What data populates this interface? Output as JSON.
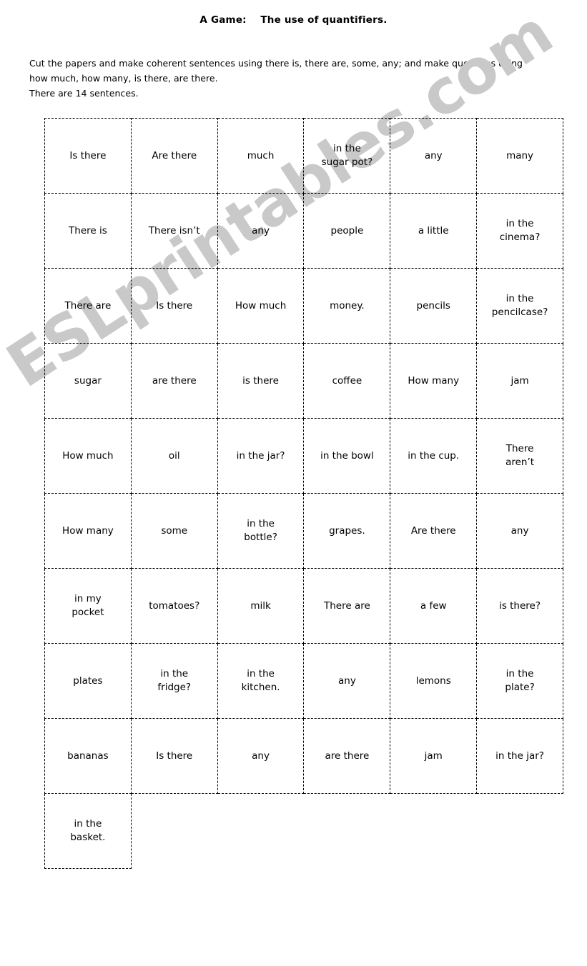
{
  "document": {
    "title": "A Game:    The use of quantifiers.",
    "instructions": {
      "line1": "Cut the papers and make coherent sentences using there is, there are, some, any; and make questions using",
      "line2": "how much, how many, is there, are there.",
      "line3": "There are 14 sentences."
    },
    "watermark": "ESLprintables.com",
    "colors": {
      "text": "#000000",
      "watermark": "#c9c9c9",
      "background": "#ffffff",
      "border": "#000000"
    }
  },
  "table": {
    "columns": 6,
    "rows": [
      [
        "Is there",
        "Are there",
        "much",
        "in the\nsugar pot?",
        "any",
        "many"
      ],
      [
        "There is",
        "There isn’t",
        "any",
        "people",
        "a little",
        "in the\ncinema?"
      ],
      [
        "There are",
        "Is there",
        "How much",
        "money.",
        "pencils",
        "in the\npencilcase?"
      ],
      [
        "sugar",
        "are there",
        "is there",
        "coffee",
        "How many",
        "jam"
      ],
      [
        "How much",
        "oil",
        "in the jar?",
        "in the bowl",
        "in the cup.",
        "There\naren’t"
      ],
      [
        "How many",
        "some",
        "in the\nbottle?",
        "grapes.",
        "Are there",
        "any"
      ],
      [
        "in my\npocket",
        "tomatoes?",
        "milk",
        "There are",
        "a few",
        "is there?"
      ],
      [
        "plates",
        "in the\nfridge?",
        "in the\nkitchen.",
        "any",
        "lemons",
        "in the\nplate?"
      ],
      [
        "bananas",
        "Is there",
        "any",
        "are there",
        "jam",
        "in the jar?"
      ],
      [
        "in the\nbasket.",
        "",
        "",
        "",
        "",
        ""
      ]
    ],
    "last_row_filled_cells": 1
  }
}
